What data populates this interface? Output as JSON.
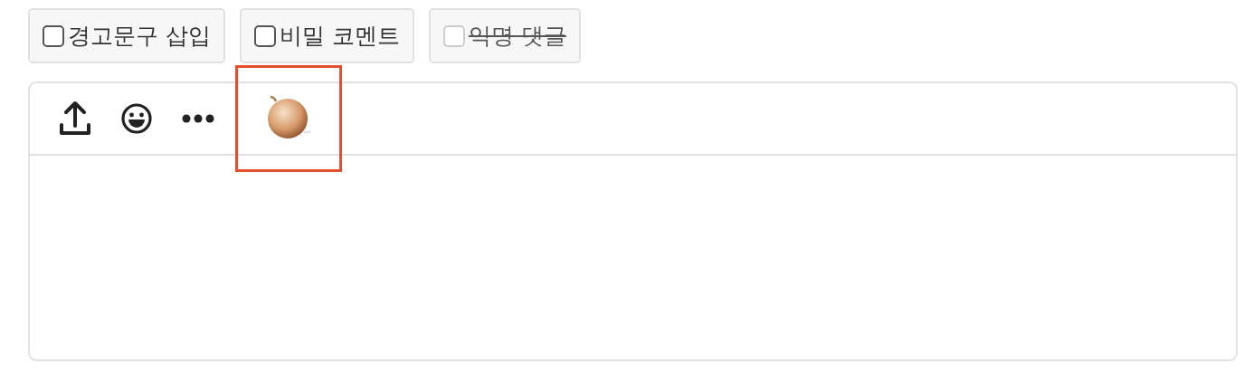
{
  "options": [
    {
      "label": "경고문구 삽입",
      "checked": false,
      "disabled": false
    },
    {
      "label": "비밀 코멘트",
      "checked": false,
      "disabled": false
    },
    {
      "label": "익명 댓글",
      "checked": false,
      "disabled": true
    }
  ],
  "editor": {
    "toolbar": [
      {
        "kind": "upload",
        "highlighted": false
      },
      {
        "kind": "emoji",
        "highlighted": false
      },
      {
        "kind": "more",
        "highlighted": false
      },
      {
        "kind": "onion",
        "highlighted": true
      }
    ]
  }
}
